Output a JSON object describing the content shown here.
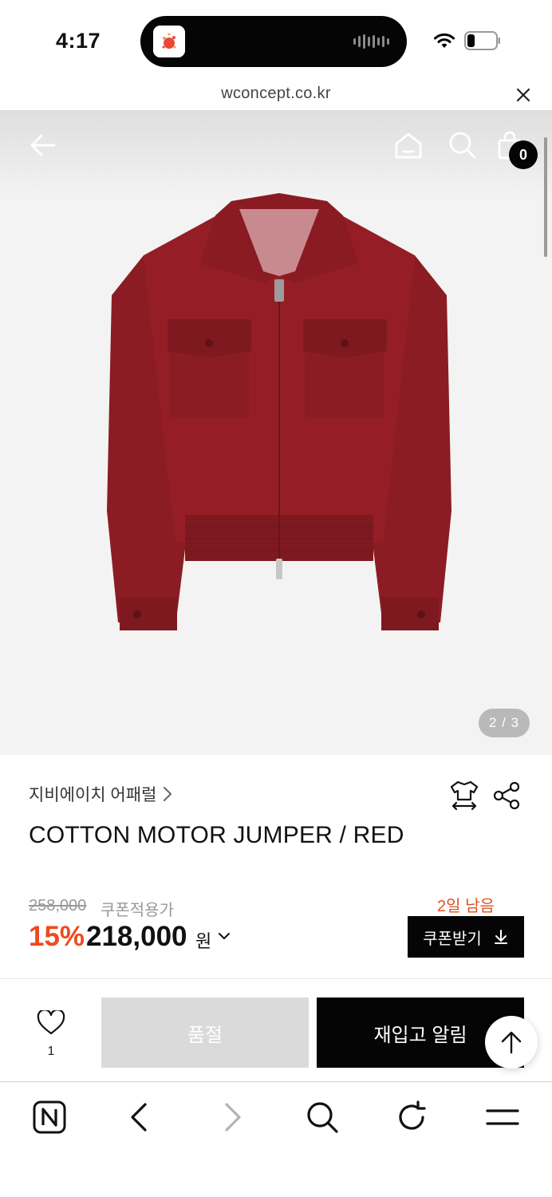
{
  "status_bar": {
    "time": "4:17"
  },
  "browser": {
    "url": "wconcept.co.kr"
  },
  "header": {
    "cart_count": "0"
  },
  "gallery": {
    "counter": "2 / 3"
  },
  "product": {
    "brand": "지비에이치 어패럴",
    "title": "COTTON MOTOR JUMPER / RED",
    "original_price": "258,000",
    "coupon_label": "쿠폰적용가",
    "discount": "15%",
    "price": "218,000",
    "currency": "원",
    "coupon_days_left": "2일 남음",
    "coupon_button": "쿠폰받기"
  },
  "actions": {
    "wish_count": "1",
    "sold_out": "품절",
    "restock_alert": "재입고 알림"
  },
  "colors": {
    "accent": "#ee4a1e",
    "jacket": "#8f1d24",
    "black": "#050505"
  },
  "icons": [
    "back-arrow-icon",
    "home-icon",
    "search-icon",
    "shopping-bag-icon",
    "size-guide-icon",
    "share-icon",
    "heart-icon",
    "download-icon",
    "arrow-up-icon",
    "naver-icon",
    "chevron-left-icon",
    "chevron-right-icon",
    "reload-icon",
    "menu-icon",
    "close-icon"
  ]
}
